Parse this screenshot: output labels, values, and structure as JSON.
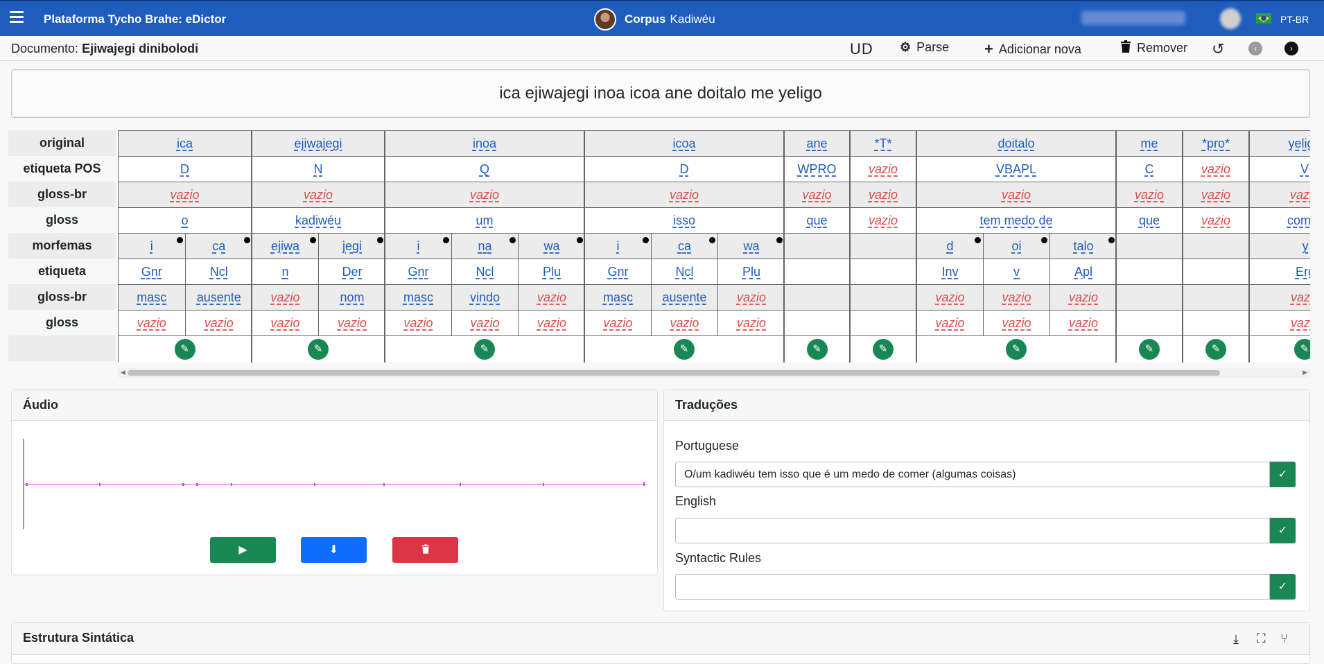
{
  "navbar": {
    "brand": "Plataforma Tycho Brahe: eDictor",
    "corpus_label": "Corpus",
    "corpus_name": "Kadiwéu",
    "lang": "PT-BR"
  },
  "toolbar": {
    "doc_label": "Documento:",
    "doc_name": "Ejiwajegi dinibolodi",
    "ud": "UD",
    "parse": "Parse",
    "add": "Adicionar nova",
    "remove": "Remover"
  },
  "sentence": "ica ejiwajegi inoa icoa ane doitalo me yeligo",
  "row_labels": [
    "original",
    "etiqueta POS",
    "gloss-br",
    "gloss",
    "morfemas",
    "etiqueta",
    "gloss-br",
    "gloss"
  ],
  "words": [
    {
      "original": "ica",
      "pos": "D",
      "gloss_br": "vazio",
      "gloss": "o",
      "morphs": [
        {
          "m": "i",
          "tag": "Gnr",
          "gbr": "masc",
          "g": "vazio"
        },
        {
          "m": "ca",
          "tag": "Ncl",
          "gbr": "ausente",
          "g": "vazio"
        }
      ]
    },
    {
      "original": "ejiwajegi",
      "pos": "N",
      "gloss_br": "vazio",
      "gloss": "kadiwéu",
      "morphs": [
        {
          "m": "ejiwa",
          "tag": "n",
          "gbr": "vazio",
          "g": "vazio"
        },
        {
          "m": "jegi",
          "tag": "Der",
          "gbr": "nom",
          "g": "vazio"
        }
      ]
    },
    {
      "original": "inoa",
      "pos": "Q",
      "gloss_br": "vazio",
      "gloss": "um",
      "morphs": [
        {
          "m": "i",
          "tag": "Gnr",
          "gbr": "masc",
          "g": "vazio"
        },
        {
          "m": "na",
          "tag": "Ncl",
          "gbr": "vindo",
          "g": "vazio"
        },
        {
          "m": "wa",
          "tag": "Plu",
          "gbr": "vazio",
          "g": "vazio"
        }
      ]
    },
    {
      "original": "icoa",
      "pos": "D",
      "gloss_br": "vazio",
      "gloss": "isso",
      "morphs": [
        {
          "m": "i",
          "tag": "Gnr",
          "gbr": "masc",
          "g": "vazio"
        },
        {
          "m": "ca",
          "tag": "Ncl",
          "gbr": "ausente",
          "g": "vazio"
        },
        {
          "m": "wa",
          "tag": "Plu",
          "gbr": "vazio",
          "g": "vazio"
        }
      ]
    },
    {
      "original": "ane",
      "pos": "WPRO",
      "gloss_br": "vazio",
      "gloss": "que",
      "morphs": []
    },
    {
      "original": "*T*",
      "pos": "vazio",
      "gloss_br": "vazio",
      "gloss": "vazio",
      "morphs": []
    },
    {
      "original": "doitalo",
      "pos": "VBAPL",
      "gloss_br": "vazio",
      "gloss": "tem medo de",
      "morphs": [
        {
          "m": "d",
          "tag": "Inv",
          "gbr": "vazio",
          "g": "vazio"
        },
        {
          "m": "oi",
          "tag": "v",
          "gbr": "vazio",
          "g": "vazio"
        },
        {
          "m": "talo",
          "tag": "Apl",
          "gbr": "vazio",
          "g": "vazio"
        }
      ]
    },
    {
      "original": "me",
      "pos": "C",
      "gloss_br": "vazio",
      "gloss": "que",
      "morphs": []
    },
    {
      "original": "*pro*",
      "pos": "vazio",
      "gloss_br": "vazio",
      "gloss": "vazio",
      "morphs": []
    },
    {
      "original": "yeligo",
      "pos": "V",
      "gloss_br": "vazio",
      "gloss": "comer",
      "morphs": [
        {
          "m": "y",
          "tag": "Erg",
          "gbr": "vazio",
          "g": "vazio"
        }
      ]
    }
  ],
  "audio": {
    "title": "Áudio"
  },
  "translations": {
    "title": "Traduções",
    "items": [
      {
        "label": "Portuguese",
        "value": "O/um kadiwéu tem isso que é um medo de comer (algumas coisas)"
      },
      {
        "label": "English",
        "value": ""
      },
      {
        "label": "Syntactic Rules",
        "value": ""
      }
    ]
  },
  "syntax": {
    "title": "Estrutura Sintática"
  }
}
